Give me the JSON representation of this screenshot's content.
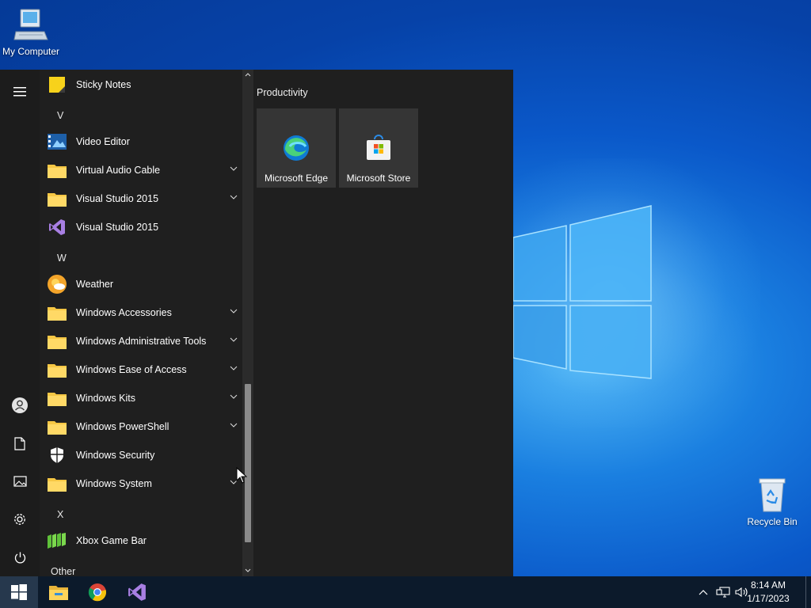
{
  "desktop": {
    "icons": [
      {
        "label": "My Computer",
        "icon": "computer-icon"
      },
      {
        "label": "Recycle Bin",
        "icon": "recycle-bin-icon"
      }
    ]
  },
  "start_menu": {
    "apps": [
      {
        "label": "Sticky Notes",
        "icon": "sticky-notes-icon",
        "expandable": false
      },
      {
        "letter": "V"
      },
      {
        "label": "Video Editor",
        "icon": "video-editor-icon",
        "expandable": false
      },
      {
        "label": "Virtual Audio Cable",
        "icon": "folder-icon",
        "expandable": true
      },
      {
        "label": "Visual Studio 2015",
        "icon": "folder-icon",
        "expandable": true
      },
      {
        "label": "Visual Studio 2015",
        "icon": "visual-studio-icon",
        "expandable": false
      },
      {
        "letter": "W"
      },
      {
        "label": "Weather",
        "icon": "weather-icon",
        "expandable": false
      },
      {
        "label": "Windows Accessories",
        "icon": "folder-icon",
        "expandable": true
      },
      {
        "label": "Windows Administrative Tools",
        "icon": "folder-icon",
        "expandable": true
      },
      {
        "label": "Windows Ease of Access",
        "icon": "folder-icon",
        "expandable": true
      },
      {
        "label": "Windows Kits",
        "icon": "folder-icon",
        "expandable": true
      },
      {
        "label": "Windows PowerShell",
        "icon": "folder-icon",
        "expandable": true
      },
      {
        "label": "Windows Security",
        "icon": "shield-icon",
        "expandable": false
      },
      {
        "label": "Windows System",
        "icon": "folder-icon",
        "expandable": true
      },
      {
        "letter": "X"
      },
      {
        "label": "Xbox Game Bar",
        "icon": "xbox-game-bar-icon",
        "expandable": false
      },
      {
        "letter": "Other"
      }
    ],
    "rail": [
      "hamburger-menu-icon",
      "user-icon",
      "documents-icon",
      "pictures-icon",
      "settings-gear-icon",
      "power-icon"
    ],
    "tiles_group": "Productivity",
    "tiles": [
      {
        "label": "Microsoft Edge",
        "icon": "edge-icon"
      },
      {
        "label": "Microsoft Store",
        "icon": "store-icon"
      }
    ]
  },
  "taskbar": {
    "pinned": [
      "file-explorer-icon",
      "chrome-icon",
      "visual-studio-icon"
    ],
    "tray": [
      "chevron-up-icon",
      "network-icon",
      "volume-icon"
    ],
    "time": "8:14 AM",
    "date": "1/17/2023"
  },
  "colors": {
    "accent": "#0a58c9",
    "menu_bg": "#1f1f1f",
    "taskbar_bg": "#0c1a2b",
    "folder": "#f6c744"
  }
}
